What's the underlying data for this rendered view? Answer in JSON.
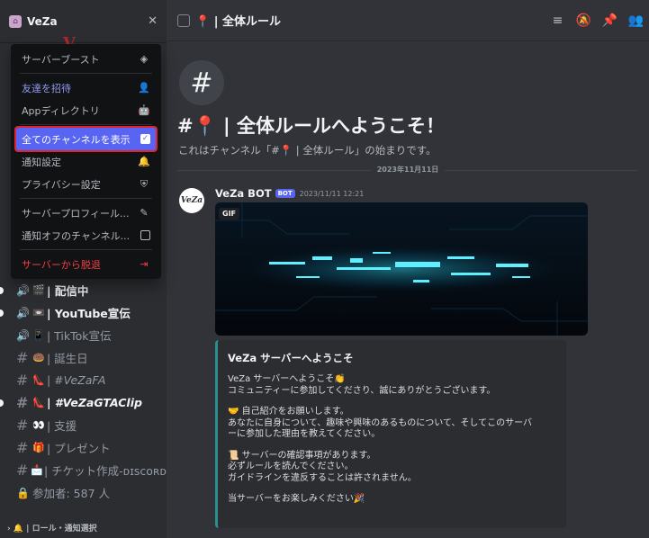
{
  "server": {
    "name": "VeZa",
    "banner_text": "V"
  },
  "menu": {
    "items": [
      {
        "label": "サーバーブースト",
        "icon": "boost-icon",
        "glyph": "◈"
      },
      {
        "label": "友達を招待",
        "icon": "add-user-icon",
        "glyph": "👤"
      },
      {
        "label": "Appディレクトリ",
        "icon": "bot-icon",
        "glyph": "🤖"
      },
      {
        "label": "全てのチャンネルを表示",
        "icon": "checkbox-checked-icon",
        "glyph": "✓"
      },
      {
        "label": "通知設定",
        "icon": "bell-icon",
        "glyph": "🔔"
      },
      {
        "label": "プライバシー設定",
        "icon": "shield-icon",
        "glyph": "⛨"
      },
      {
        "label": "サーバープロフィール...",
        "icon": "pencil-icon",
        "glyph": "✎"
      },
      {
        "label": "通知オフのチャンネル...",
        "icon": "checkbox-empty-icon",
        "glyph": ""
      },
      {
        "label": "サーバーから脱退",
        "icon": "leave-icon",
        "glyph": "⇥"
      }
    ]
  },
  "channels": [
    {
      "label": "| 配信中",
      "emoji": "🎬",
      "type": "voice",
      "bold": true,
      "unread": true,
      "italic": false
    },
    {
      "label": "| YouTube宣伝",
      "emoji": "📼",
      "type": "voice",
      "bold": true,
      "unread": true,
      "italic": false
    },
    {
      "label": "| TikTok宣伝",
      "emoji": "📱",
      "type": "voice",
      "bold": false,
      "unread": false,
      "italic": false
    },
    {
      "label": "| 誕生日",
      "emoji": "🍩",
      "type": "text",
      "bold": false,
      "unread": false,
      "italic": false
    },
    {
      "label": "| #VeZaFA",
      "emoji": "👠",
      "type": "text",
      "bold": false,
      "unread": false,
      "italic": true
    },
    {
      "label": "| #VeZaGTAClip",
      "emoji": "👠",
      "type": "text",
      "bold": true,
      "unread": true,
      "italic": true
    },
    {
      "label": "| 支援",
      "emoji": "👀",
      "type": "text",
      "bold": false,
      "unread": false,
      "italic": false
    },
    {
      "label": "| プレゼント",
      "emoji": "🎁",
      "type": "text",
      "bold": false,
      "unread": false,
      "italic": false
    },
    {
      "label": "| チケット作成-ᴅɪsᴄᴏʀᴅ",
      "emoji": "📩",
      "type": "text",
      "bold": false,
      "unread": false,
      "italic": false
    },
    {
      "label": "参加者: 587 人",
      "emoji": "",
      "type": "lock",
      "bold": false,
      "unread": false,
      "italic": false
    }
  ],
  "footer_category": "› 🔔 | ロール・通知選択",
  "topbar": {
    "channel_title": "📍 | 全体ルール",
    "tools": [
      "threads-icon",
      "mute-icon",
      "pin-icon",
      "members-icon"
    ]
  },
  "main": {
    "hash_symbol": "#",
    "welcome_title": "#📍 | 全体ルールへようこそ！",
    "welcome_sub": "これはチャンネル「#📍 | 全体ルール」の始まりです。",
    "date_divider": "2023年11月11日",
    "message": {
      "avatar_text": "VeZa",
      "author": "VeZa BOT",
      "bot_tag": "BOT",
      "timestamp": "2023/11/11 12:21",
      "gif_badge": "GIF"
    },
    "embed": {
      "title": "VeZa サーバーへようこそ",
      "lines": [
        "VeZa サーバーへようこそ👏",
        "コミュニティーに参加してくださり、誠にありがとうございます。",
        "",
        "🤝 自己紹介をお願いします。",
        "あなたに自身について、趣味や興味のあるものについて、そしてこのサーバ",
        "ーに参加した理由を教えてください。",
        "",
        "📜 サーバーの確認事項があります。",
        "必ずルールを読んでください。",
        "ガイドラインを違反することは許されません。",
        "",
        "当サーバーをお楽しみください🎉"
      ]
    }
  },
  "colors": {
    "blurple": "#5865f2",
    "danger": "#f23f42",
    "highlight_outline": "#e0242d",
    "embed_accent": "#2a8f8f"
  }
}
